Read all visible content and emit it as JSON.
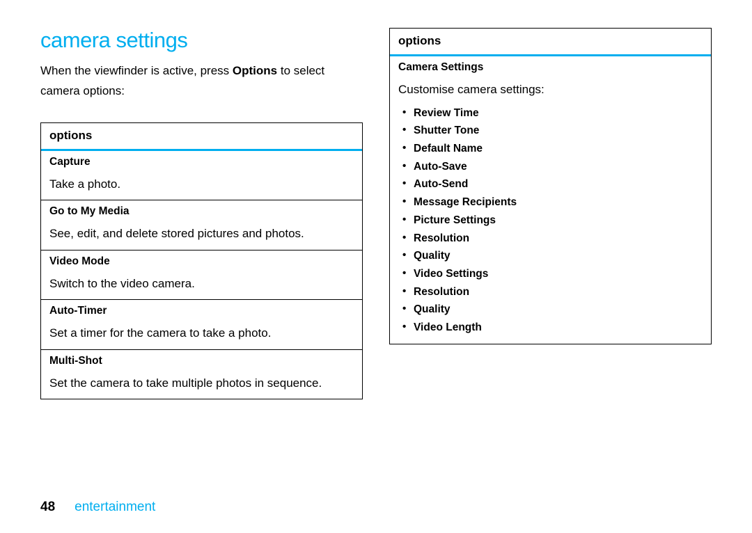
{
  "heading": "camera settings",
  "intro_before": "When the viewfinder is active, press ",
  "intro_bold": "Options",
  "intro_after": " to select camera options:",
  "left_table": {
    "header": "options",
    "rows": [
      {
        "title": "Capture",
        "desc": "Take a photo."
      },
      {
        "title": "Go to My Media",
        "desc": "See, edit, and delete stored pictures and photos."
      },
      {
        "title": "Video Mode",
        "desc": "Switch to the video camera."
      },
      {
        "title": "Auto-Timer",
        "desc": "Set a timer for the camera to take a photo."
      },
      {
        "title": "Multi-Shot",
        "desc": "Set the camera to take multiple photos in sequence."
      }
    ]
  },
  "right_table": {
    "header": "options",
    "title": "Camera Settings",
    "desc": "Customise camera settings:",
    "bullets": [
      "Review Time",
      "Shutter Tone",
      "Default Name",
      "Auto-Save",
      "Auto-Send",
      "Message Recipients",
      "Picture Settings",
      "Resolution",
      "Quality",
      "Video Settings",
      "Resolution",
      "Quality",
      "Video Length"
    ]
  },
  "footer": {
    "page": "48",
    "section": "entertainment"
  }
}
